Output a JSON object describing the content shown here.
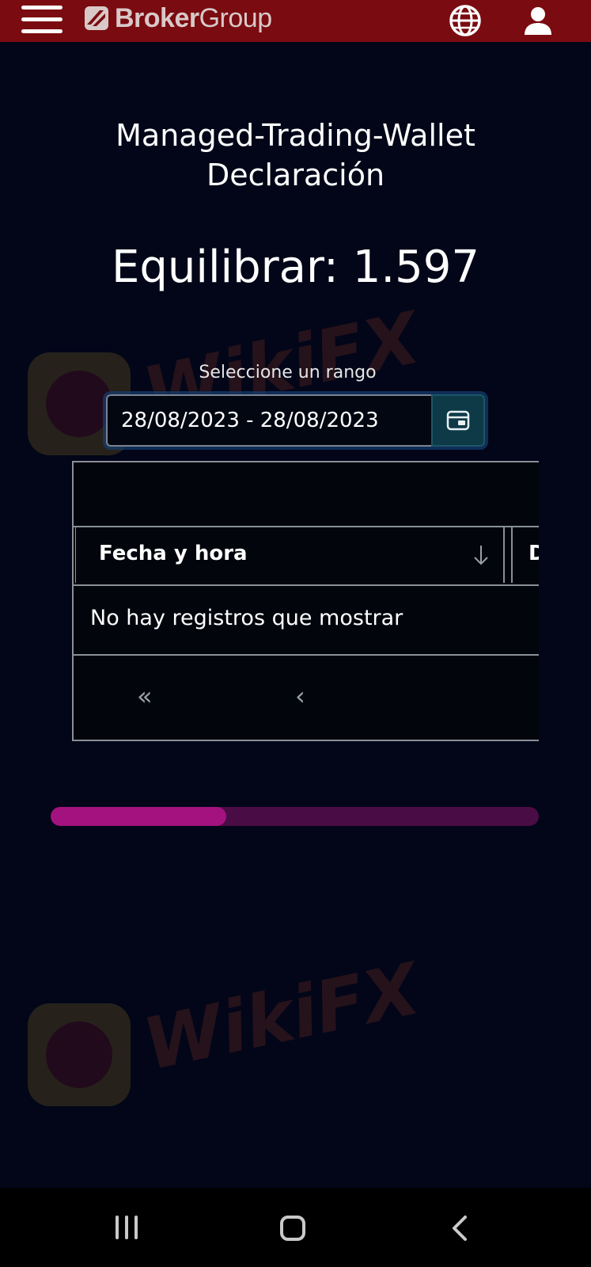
{
  "header": {
    "brand_bold": "Broker",
    "brand_light": "Group",
    "menu_icon": "hamburger-menu-icon",
    "language_icon": "globe-icon",
    "account_icon": "user-icon",
    "bar_color": "#7a0b10"
  },
  "page": {
    "title_line1": "Managed-Trading-Wallet",
    "title_line2": "Declaración",
    "balance_label": "Equilibrar: ",
    "balance_value": "1.597"
  },
  "range": {
    "label": "Seleccione un rango",
    "value": "28/08/2023 - 28/08/2023",
    "calendar_icon": "calendar-icon"
  },
  "table": {
    "columns": [
      "Fecha y hora",
      "D"
    ],
    "sort_icon": "arrow-down-icon",
    "empty_message": "No hay registros que mostrar",
    "pager_first": "«",
    "pager_prev": "‹"
  },
  "progress": {
    "fraction": 0.36,
    "fill_color": "#a4127f",
    "track_color": "#4a0c45"
  },
  "watermark": {
    "text": "WikiFX"
  },
  "system_nav": {
    "recent_icon": "recent-apps-icon",
    "home_icon": "home-icon",
    "back_icon": "back-icon"
  }
}
